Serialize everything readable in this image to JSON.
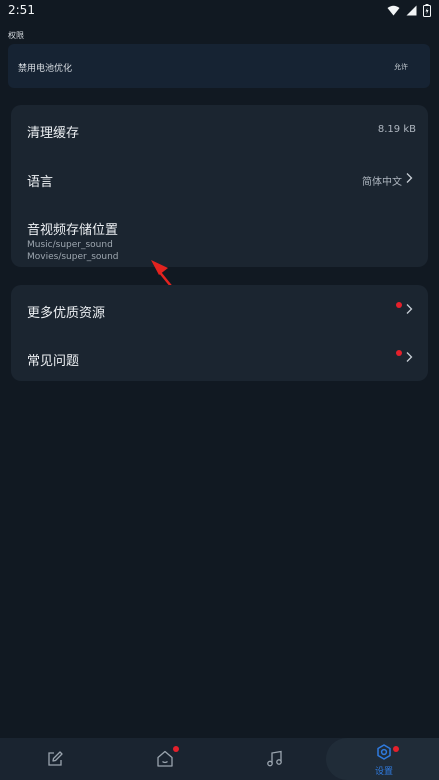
{
  "status_bar": {
    "time": "2:51"
  },
  "permissions": {
    "section_label": "权限",
    "item_label": "禁用电池优化",
    "action_label": "允许"
  },
  "settings_card": {
    "clear_cache": {
      "label": "清理缓存",
      "value": "8.19 kB"
    },
    "language": {
      "label": "语言",
      "value": "简体中文"
    },
    "storage": {
      "label": "音视频存储位置",
      "path1": "Music/super_sound",
      "path2": "Movies/super_sound"
    }
  },
  "more_card": {
    "resources": {
      "label": "更多优质资源"
    },
    "faq": {
      "label": "常见问题"
    }
  },
  "bottom_nav": {
    "items": [
      {
        "icon": "edit-icon"
      },
      {
        "icon": "home-icon"
      },
      {
        "icon": "music-icon"
      },
      {
        "icon": "settings-icon",
        "label": "设置"
      }
    ],
    "accent_color": "#2f7be0",
    "badge_color": "#e5202b"
  }
}
